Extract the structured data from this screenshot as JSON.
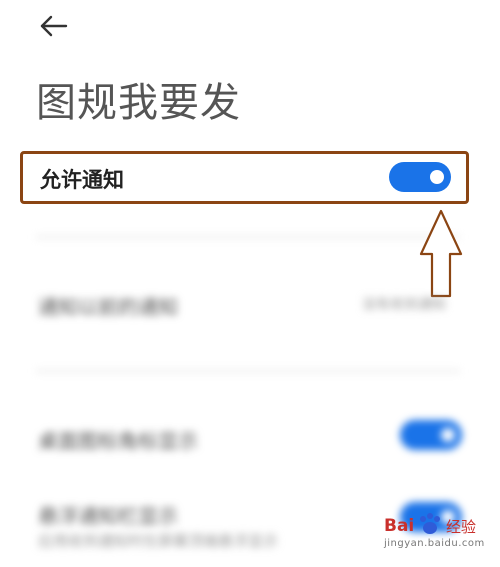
{
  "header": {
    "back_icon": "arrow-left-icon",
    "title": "图规我要发"
  },
  "notification_row": {
    "label": "允许通知",
    "enabled": true
  },
  "settings_rows": [
    {
      "label": "通知以前的通知",
      "value": "没有收到通知"
    },
    {
      "label": "桌面图标角标显示",
      "enabled": true
    },
    {
      "label": "悬浮通知栏显示",
      "subtext": "应用收到通知时在屏幕顶端悬浮显示",
      "enabled": true
    }
  ],
  "annotation": {
    "icon": "up-arrow-outline-icon",
    "color": "#8B4513"
  },
  "watermark": {
    "brand": "Bai",
    "cn": "经验",
    "url": "jingyan.baidu.com"
  },
  "colors": {
    "toggle_on": "#1a73e8",
    "highlight_border": "#8B4513",
    "title_text": "#555555",
    "watermark_red": "#c9302c"
  }
}
